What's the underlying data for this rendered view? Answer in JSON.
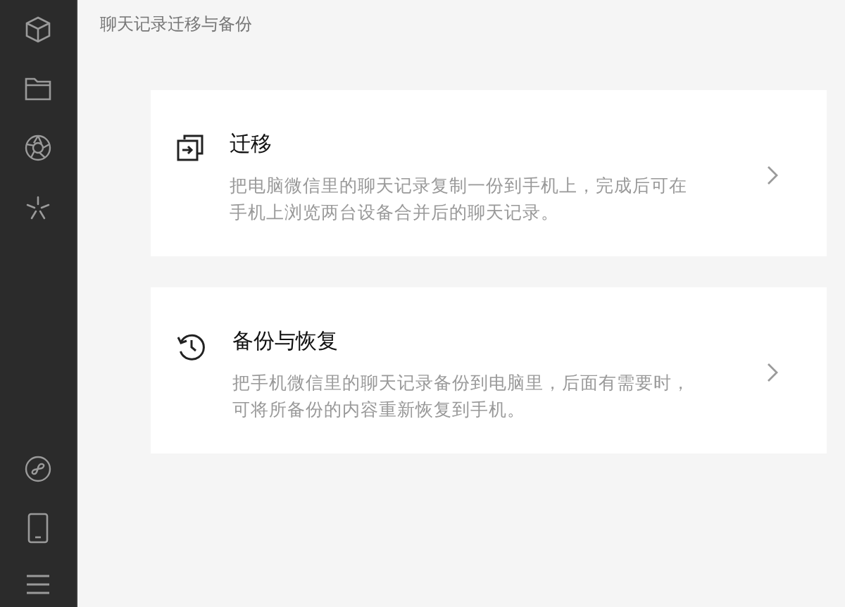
{
  "header": {
    "title": "聊天记录迁移与备份"
  },
  "options": [
    {
      "kind": "migrate",
      "title": "迁移",
      "description_lines": [
        "把电脑微信里的聊天记录复制一份到手机上，完成后可在",
        "手机上浏览两台设备合并后的聊天记录。"
      ]
    },
    {
      "kind": "backup",
      "title": "备份与恢复",
      "description_lines": [
        "把手机微信里的聊天记录备份到电脑里，后面有需要时，",
        "可将所备份的内容重新恢复到手机。"
      ]
    }
  ]
}
